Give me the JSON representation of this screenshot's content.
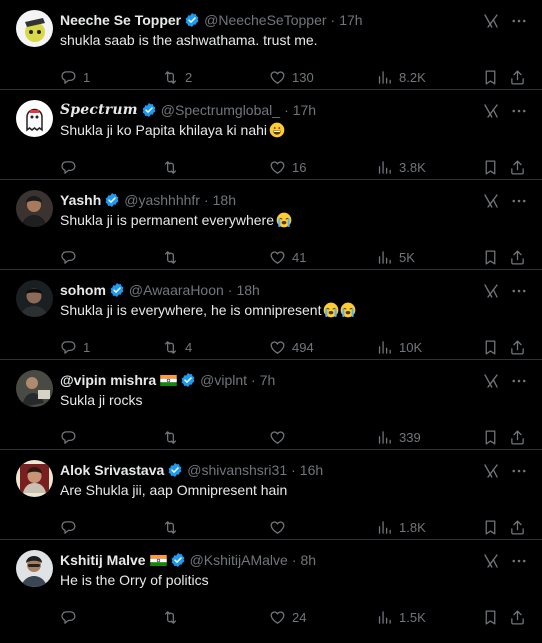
{
  "colors": {
    "background": "#000000",
    "text": "#e7e9ea",
    "muted": "#71767b",
    "verified": "#1d9bf0",
    "divider": "#2f3336"
  },
  "tweets": [
    {
      "name": "Neeche Se Topper",
      "handle": "@NeecheSeTopper",
      "time": "17h",
      "text": "shukla saab is the ashwathama. trust me.",
      "replies": "1",
      "retweets": "2",
      "likes": "130",
      "views": "8.2K",
      "flag": false,
      "emoji": ""
    },
    {
      "name": "Spectrum",
      "handle": "@Spectrumglobal_",
      "time": "17h",
      "text": "Shukla ji ko Papita khilaya ki nahi",
      "replies": "",
      "retweets": "",
      "likes": "16",
      "views": "3.8K",
      "flag": false,
      "emoji": "grin"
    },
    {
      "name": "Yashh",
      "handle": "@yashhhhfr",
      "time": "18h",
      "text": "Shukla ji is permanent everywhere",
      "replies": "",
      "retweets": "",
      "likes": "41",
      "views": "5K",
      "flag": false,
      "emoji": "cry"
    },
    {
      "name": "sohom",
      "handle": "@AwaaraHoon",
      "time": "18h",
      "text": "Shukla ji is everywhere, he is omnipresent",
      "replies": "1",
      "retweets": "4",
      "likes": "494",
      "views": "10K",
      "flag": false,
      "emoji": "cry2"
    },
    {
      "name": "@vipin mishra",
      "handle": "@viplnt",
      "time": "7h",
      "text": "Sukla ji rocks",
      "replies": "",
      "retweets": "",
      "likes": "",
      "views": "339",
      "flag": true,
      "emoji": ""
    },
    {
      "name": "Alok Srivastava",
      "handle": "@shivanshsri31",
      "time": "16h",
      "text": "Are Shukla jii, aap Omnipresent hain",
      "replies": "",
      "retweets": "",
      "likes": "",
      "views": "1.8K",
      "flag": false,
      "emoji": ""
    },
    {
      "name": "Kshitij Malve",
      "handle": "@KshitijAMalve",
      "time": "8h",
      "text": "He is the Orry of politics",
      "replies": "",
      "retweets": "",
      "likes": "24",
      "views": "1.5K",
      "flag": true,
      "emoji": ""
    }
  ]
}
